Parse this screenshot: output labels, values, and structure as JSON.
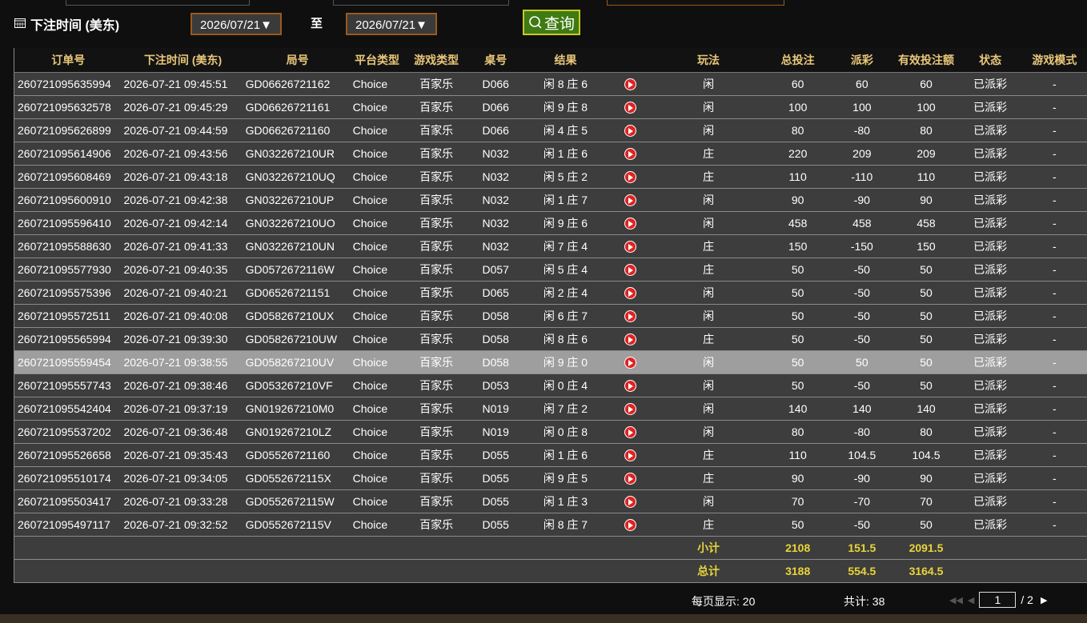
{
  "filter": {
    "label": "下注时间 (美东)",
    "date_from": "2026/07/21▼",
    "to": "至",
    "date_to": "2026/07/21▼",
    "query": "查询"
  },
  "columns": [
    "订单号",
    "下注时间 (美东)",
    "局号",
    "平台类型",
    "游戏类型",
    "桌号",
    "结果",
    "",
    "玩法",
    "总投注",
    "派彩",
    "有效投注额",
    "状态",
    "游戏模式"
  ],
  "rows": [
    {
      "order": "260721095635994",
      "time": "2026-07-21 09:45:51",
      "round": "GD06626721162",
      "platform": "Choice",
      "game": "百家乐",
      "table": "D066",
      "result": "闲 8 庄 6",
      "bet_type": "闲",
      "total": "60",
      "payout": "60",
      "payout_sign": "pos",
      "valid": "60",
      "status": "已派彩",
      "mode": "-"
    },
    {
      "order": "260721095632578",
      "time": "2026-07-21 09:45:29",
      "round": "GD06626721161",
      "platform": "Choice",
      "game": "百家乐",
      "table": "D066",
      "result": "闲 9 庄 8",
      "bet_type": "闲",
      "total": "100",
      "payout": "100",
      "payout_sign": "pos",
      "valid": "100",
      "status": "已派彩",
      "mode": "-"
    },
    {
      "order": "260721095626899",
      "time": "2026-07-21 09:44:59",
      "round": "GD06626721160",
      "platform": "Choice",
      "game": "百家乐",
      "table": "D066",
      "result": "闲 4 庄 5",
      "bet_type": "闲",
      "total": "80",
      "payout": "-80",
      "payout_sign": "neg",
      "valid": "80",
      "status": "已派彩",
      "mode": "-"
    },
    {
      "order": "260721095614906",
      "time": "2026-07-21 09:43:56",
      "round": "GN032267210UR",
      "platform": "Choice",
      "game": "百家乐",
      "table": "N032",
      "result": "闲 1 庄 6",
      "bet_type": "庄",
      "total": "220",
      "payout": "209",
      "payout_sign": "pos",
      "valid": "209",
      "status": "已派彩",
      "mode": "-"
    },
    {
      "order": "260721095608469",
      "time": "2026-07-21 09:43:18",
      "round": "GN032267210UQ",
      "platform": "Choice",
      "game": "百家乐",
      "table": "N032",
      "result": "闲 5 庄 2",
      "bet_type": "庄",
      "total": "110",
      "payout": "-110",
      "payout_sign": "neg",
      "valid": "110",
      "status": "已派彩",
      "mode": "-"
    },
    {
      "order": "260721095600910",
      "time": "2026-07-21 09:42:38",
      "round": "GN032267210UP",
      "platform": "Choice",
      "game": "百家乐",
      "table": "N032",
      "result": "闲 1 庄 7",
      "bet_type": "闲",
      "total": "90",
      "payout": "-90",
      "payout_sign": "neg",
      "valid": "90",
      "status": "已派彩",
      "mode": "-"
    },
    {
      "order": "260721095596410",
      "time": "2026-07-21 09:42:14",
      "round": "GN032267210UO",
      "platform": "Choice",
      "game": "百家乐",
      "table": "N032",
      "result": "闲 9 庄 6",
      "bet_type": "闲",
      "total": "458",
      "payout": "458",
      "payout_sign": "pos",
      "valid": "458",
      "status": "已派彩",
      "mode": "-"
    },
    {
      "order": "260721095588630",
      "time": "2026-07-21 09:41:33",
      "round": "GN032267210UN",
      "platform": "Choice",
      "game": "百家乐",
      "table": "N032",
      "result": "闲 7 庄 4",
      "bet_type": "庄",
      "total": "150",
      "payout": "-150",
      "payout_sign": "neg",
      "valid": "150",
      "status": "已派彩",
      "mode": "-"
    },
    {
      "order": "260721095577930",
      "time": "2026-07-21 09:40:35",
      "round": "GD0572672116W",
      "platform": "Choice",
      "game": "百家乐",
      "table": "D057",
      "result": "闲 5 庄 4",
      "bet_type": "庄",
      "total": "50",
      "payout": "-50",
      "payout_sign": "neg",
      "valid": "50",
      "status": "已派彩",
      "mode": "-"
    },
    {
      "order": "260721095575396",
      "time": "2026-07-21 09:40:21",
      "round": "GD06526721151",
      "platform": "Choice",
      "game": "百家乐",
      "table": "D065",
      "result": "闲 2 庄 4",
      "bet_type": "闲",
      "total": "50",
      "payout": "-50",
      "payout_sign": "neg",
      "valid": "50",
      "status": "已派彩",
      "mode": "-"
    },
    {
      "order": "260721095572511",
      "time": "2026-07-21 09:40:08",
      "round": "GD058267210UX",
      "platform": "Choice",
      "game": "百家乐",
      "table": "D058",
      "result": "闲 6 庄 7",
      "bet_type": "闲",
      "total": "50",
      "payout": "-50",
      "payout_sign": "neg",
      "valid": "50",
      "status": "已派彩",
      "mode": "-"
    },
    {
      "order": "260721095565994",
      "time": "2026-07-21 09:39:30",
      "round": "GD058267210UW",
      "platform": "Choice",
      "game": "百家乐",
      "table": "D058",
      "result": "闲 8 庄 6",
      "bet_type": "庄",
      "total": "50",
      "payout": "-50",
      "payout_sign": "neg",
      "valid": "50",
      "status": "已派彩",
      "mode": "-"
    },
    {
      "order": "260721095559454",
      "time": "2026-07-21 09:38:55",
      "round": "GD058267210UV",
      "platform": "Choice",
      "game": "百家乐",
      "table": "D058",
      "result": "闲 9 庄 0",
      "bet_type": "闲",
      "total": "50",
      "payout": "50",
      "payout_sign": "pos",
      "valid": "50",
      "status": "已派彩",
      "mode": "-",
      "highlight": true
    },
    {
      "order": "260721095557743",
      "time": "2026-07-21 09:38:46",
      "round": "GD053267210VF",
      "platform": "Choice",
      "game": "百家乐",
      "table": "D053",
      "result": "闲 0 庄 4",
      "bet_type": "闲",
      "total": "50",
      "payout": "-50",
      "payout_sign": "neg",
      "valid": "50",
      "status": "已派彩",
      "mode": "-"
    },
    {
      "order": "260721095542404",
      "time": "2026-07-21 09:37:19",
      "round": "GN019267210M0",
      "platform": "Choice",
      "game": "百家乐",
      "table": "N019",
      "result": "闲 7 庄 2",
      "bet_type": "闲",
      "total": "140",
      "payout": "140",
      "payout_sign": "pos",
      "valid": "140",
      "status": "已派彩",
      "mode": "-"
    },
    {
      "order": "260721095537202",
      "time": "2026-07-21 09:36:48",
      "round": "GN019267210LZ",
      "platform": "Choice",
      "game": "百家乐",
      "table": "N019",
      "result": "闲 0 庄 8",
      "bet_type": "闲",
      "total": "80",
      "payout": "-80",
      "payout_sign": "neg",
      "valid": "80",
      "status": "已派彩",
      "mode": "-"
    },
    {
      "order": "260721095526658",
      "time": "2026-07-21 09:35:43",
      "round": "GD05526721160",
      "platform": "Choice",
      "game": "百家乐",
      "table": "D055",
      "result": "闲 1 庄 6",
      "bet_type": "庄",
      "total": "110",
      "payout": "104.5",
      "payout_sign": "pos",
      "valid": "104.5",
      "status": "已派彩",
      "mode": "-"
    },
    {
      "order": "260721095510174",
      "time": "2026-07-21 09:34:05",
      "round": "GD0552672115X",
      "platform": "Choice",
      "game": "百家乐",
      "table": "D055",
      "result": "闲 9 庄 5",
      "bet_type": "庄",
      "total": "90",
      "payout": "-90",
      "payout_sign": "neg",
      "valid": "90",
      "status": "已派彩",
      "mode": "-"
    },
    {
      "order": "260721095503417",
      "time": "2026-07-21 09:33:28",
      "round": "GD0552672115W",
      "platform": "Choice",
      "game": "百家乐",
      "table": "D055",
      "result": "闲 1 庄 3",
      "bet_type": "闲",
      "total": "70",
      "payout": "-70",
      "payout_sign": "neg",
      "valid": "70",
      "status": "已派彩",
      "mode": "-"
    },
    {
      "order": "260721095497117",
      "time": "2026-07-21 09:32:52",
      "round": "GD0552672115V",
      "platform": "Choice",
      "game": "百家乐",
      "table": "D055",
      "result": "闲 8 庄 7",
      "bet_type": "庄",
      "total": "50",
      "payout": "-50",
      "payout_sign": "neg",
      "valid": "50",
      "status": "已派彩",
      "mode": "-"
    }
  ],
  "subtotal": {
    "label": "小计",
    "total": "2108",
    "payout": "151.5",
    "valid": "2091.5"
  },
  "grandtotal": {
    "label": "总计",
    "total": "3188",
    "payout": "554.5",
    "valid": "3164.5"
  },
  "footer": {
    "per_page": "每页显示: 20",
    "count": "共计: 38",
    "page": "1",
    "pages": "/ 2"
  },
  "colors": {
    "header_text": "#e9c77a",
    "negative": "#44dd22",
    "positive": "#ff2a2a",
    "status": "#22dd22",
    "sum_text": "#e9d43a"
  }
}
